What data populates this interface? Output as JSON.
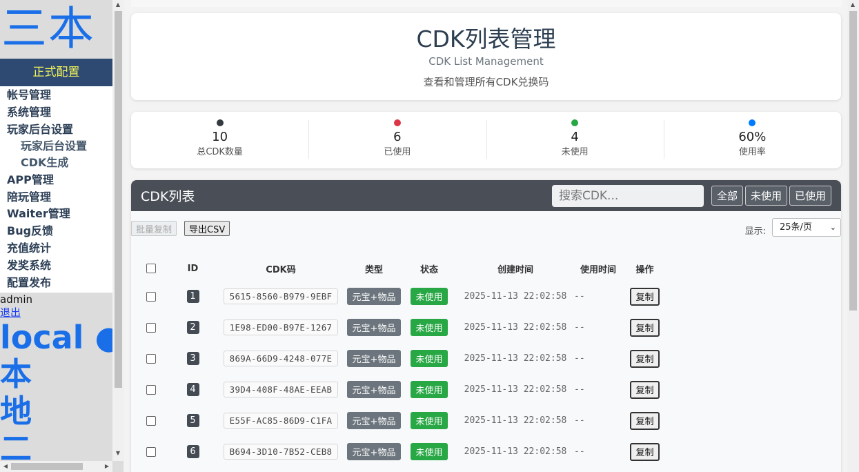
{
  "sidebar": {
    "logo": "三本",
    "config_title": "正式配置",
    "menu": [
      {
        "label": "帐号管理",
        "level": 1
      },
      {
        "label": "系统管理",
        "level": 1
      },
      {
        "label": "玩家后台设置",
        "level": 1
      },
      {
        "label": "玩家后台设置",
        "level": 2
      },
      {
        "label": "CDK生成",
        "level": 2
      },
      {
        "label": "APP管理",
        "level": 1
      },
      {
        "label": "陪玩管理",
        "level": 1
      },
      {
        "label": "Waiter管理",
        "level": 1
      },
      {
        "label": "Bug反馈",
        "level": 1
      },
      {
        "label": "充值统计",
        "level": 1
      },
      {
        "label": "发奖系统",
        "level": 1
      },
      {
        "label": "配置发布",
        "level": 1
      }
    ],
    "username": "admin",
    "logout": "退出",
    "env_label": "local ●",
    "env_vertical": [
      "本",
      "地",
      "二"
    ]
  },
  "header": {
    "title": "CDK列表管理",
    "subtitle": "CDK List Management",
    "description": "查看和管理所有CDK兑换码"
  },
  "stats": [
    {
      "value": "10",
      "label": "总CDK数量",
      "color": "#343a40"
    },
    {
      "value": "6",
      "label": "已使用",
      "color": "#dc3545"
    },
    {
      "value": "4",
      "label": "未使用",
      "color": "#28a745"
    },
    {
      "value": "60%",
      "label": "使用率",
      "color": "#007bff"
    }
  ],
  "list": {
    "title": "CDK列表",
    "search_placeholder": "搜索CDK...",
    "filters": [
      "全部",
      "未使用",
      "已使用"
    ],
    "batch_copy": "批量复制",
    "export_csv": "导出CSV",
    "show_label": "显示:",
    "per_page": "25条/页",
    "columns": [
      "ID",
      "CDK码",
      "类型",
      "状态",
      "创建时间",
      "使用时间",
      "操作"
    ],
    "rows": [
      {
        "id": "1",
        "code": "5615-8560-B979-9EBF",
        "type": "元宝+物品",
        "status": "未使用",
        "created": "2025-11-13 22:02:58",
        "used": "--",
        "action": "复制"
      },
      {
        "id": "2",
        "code": "1E98-ED00-B97E-1267",
        "type": "元宝+物品",
        "status": "未使用",
        "created": "2025-11-13 22:02:58",
        "used": "--",
        "action": "复制"
      },
      {
        "id": "3",
        "code": "869A-66D9-4248-077E",
        "type": "元宝+物品",
        "status": "未使用",
        "created": "2025-11-13 22:02:58",
        "used": "--",
        "action": "复制"
      },
      {
        "id": "4",
        "code": "39D4-408F-48AE-EEAB",
        "type": "元宝+物品",
        "status": "未使用",
        "created": "2025-11-13 22:02:58",
        "used": "--",
        "action": "复制"
      },
      {
        "id": "5",
        "code": "E55F-AC85-86D9-C1FA",
        "type": "元宝+物品",
        "status": "未使用",
        "created": "2025-11-13 22:02:58",
        "used": "--",
        "action": "复制"
      },
      {
        "id": "6",
        "code": "B694-3D10-7B52-CEB8",
        "type": "元宝+物品",
        "status": "未使用",
        "created": "2025-11-13 22:02:58",
        "used": "--",
        "action": "复制"
      }
    ]
  }
}
